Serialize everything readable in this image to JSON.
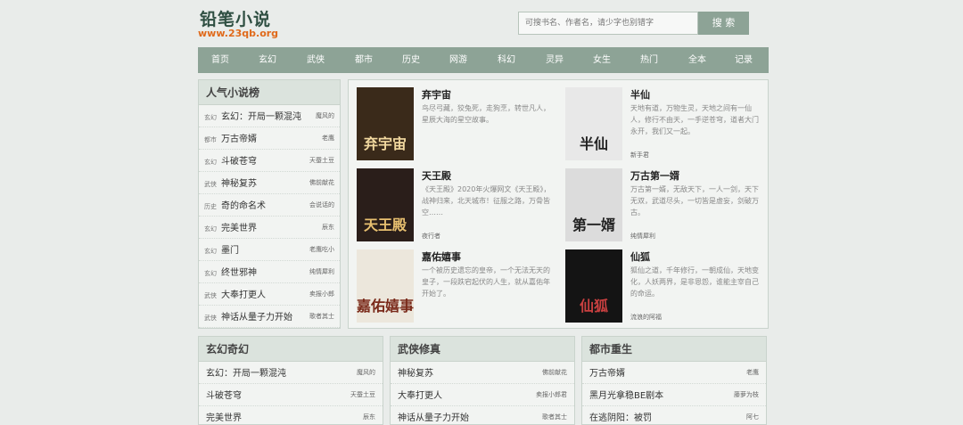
{
  "site": {
    "title": "铅笔小说",
    "url": "www.23qb.org"
  },
  "search": {
    "placeholder": "可搜书名、作者名，请少字也别错字",
    "button_label": "搜 索"
  },
  "nav": {
    "items": [
      "首页",
      "玄幻",
      "武侠",
      "都市",
      "历史",
      "网游",
      "科幻",
      "灵异",
      "女生",
      "热门",
      "全本",
      "记录"
    ]
  },
  "ranking": {
    "title": "人气小说榜",
    "items": [
      {
        "category": "玄幻",
        "name": "玄幻：开局一颗混沌",
        "author": "魔风的"
      },
      {
        "category": "都市",
        "name": "万古帝婿",
        "author": "老鹰"
      },
      {
        "category": "玄幻",
        "name": "斗破苍穹",
        "author": "天蚕土豆"
      },
      {
        "category": "武侠",
        "name": "神秘复苏",
        "author": "佛前献花"
      },
      {
        "category": "历史",
        "name": "奇的命名术",
        "author": "会说话的"
      },
      {
        "category": "玄幻",
        "name": "完美世界",
        "author": "辰东"
      },
      {
        "category": "玄幻",
        "name": "墨门",
        "author": "老鹰吃小"
      },
      {
        "category": "玄幻",
        "name": "终世邪神",
        "author": "纯情犀利"
      },
      {
        "category": "武侠",
        "name": "大奉打更人",
        "author": "卖报小郎"
      },
      {
        "category": "武侠",
        "name": "神话从量子力开始",
        "author": "歌者其士"
      }
    ]
  },
  "featured": {
    "books": [
      {
        "title": "弃宇宙",
        "desc": "鸟尽弓藏，狡兔死，走狗烹，转世凡人，星辰大海的星空故事。",
        "author": "",
        "cover_text": "弃宇宙",
        "cover_bg": "#3a2a1a",
        "cover_fg": "#f2d9a0"
      },
      {
        "title": "半仙",
        "desc": "天地有道，万物生灵，天地之间有一仙人，修行不由天，一手逆苍穹，道者大门永开，我们又一起。",
        "author": "新手君",
        "cover_text": "半仙",
        "cover_bg": "#e8e8e8",
        "cover_fg": "#222"
      },
      {
        "title": "天王殿",
        "desc": "《天王殿》2020年火爆网文《天王殿》，战神归来，北天城市！征服之路，万骨皆空……",
        "author": "夜行者",
        "cover_text": "天王殿",
        "cover_bg": "#2a1e1a",
        "cover_fg": "#e8c070"
      },
      {
        "title": "万古第一婿",
        "desc": "万古第一婿，无敌天下，一人一剑，天下无双，武道尽头，一切皆是虚妄，剑破万古。",
        "author": "纯情犀利",
        "cover_text": "第一婿",
        "cover_bg": "#dcdcdc",
        "cover_fg": "#222"
      },
      {
        "title": "嘉佑嬉事",
        "desc": "一个被历史遗忘的皇帝，一个无法无天的皇子，一段跌宕起伏的人生，就从嘉佑年开始了。",
        "author": "",
        "cover_text": "嘉佑嬉事",
        "cover_bg": "#ece7dc",
        "cover_fg": "#7a2a1a"
      },
      {
        "title": "仙狐",
        "desc": "狐仙之道，千年修行，一朝成仙，天地变化，人妖两界，是非恩怨，谁能主宰自己的命运。",
        "author": "流浪的阿福",
        "cover_text": "仙狐",
        "cover_bg": "#141414",
        "cover_fg": "#c94040"
      }
    ]
  },
  "categories": [
    {
      "title": "玄幻奇幻",
      "items": [
        {
          "name": "玄幻：开局一颗混沌",
          "author": "魔风的"
        },
        {
          "name": "斗破苍穹",
          "author": "天蚕土豆"
        },
        {
          "name": "完美世界",
          "author": "辰东"
        }
      ]
    },
    {
      "title": "武侠修真",
      "items": [
        {
          "name": "神秘复苏",
          "author": "佛前献花"
        },
        {
          "name": "大奉打更人",
          "author": "卖报小郎君"
        },
        {
          "name": "神话从量子力开始",
          "author": "歌者其士"
        }
      ]
    },
    {
      "title": "都市重生",
      "items": [
        {
          "name": "万古帝婿",
          "author": "老鹰"
        },
        {
          "name": "黑月光拿稳BE剧本",
          "author": "藤萝为枝"
        },
        {
          "name": "在逃阴阳：被罚",
          "author": "阿七"
        }
      ]
    }
  ]
}
